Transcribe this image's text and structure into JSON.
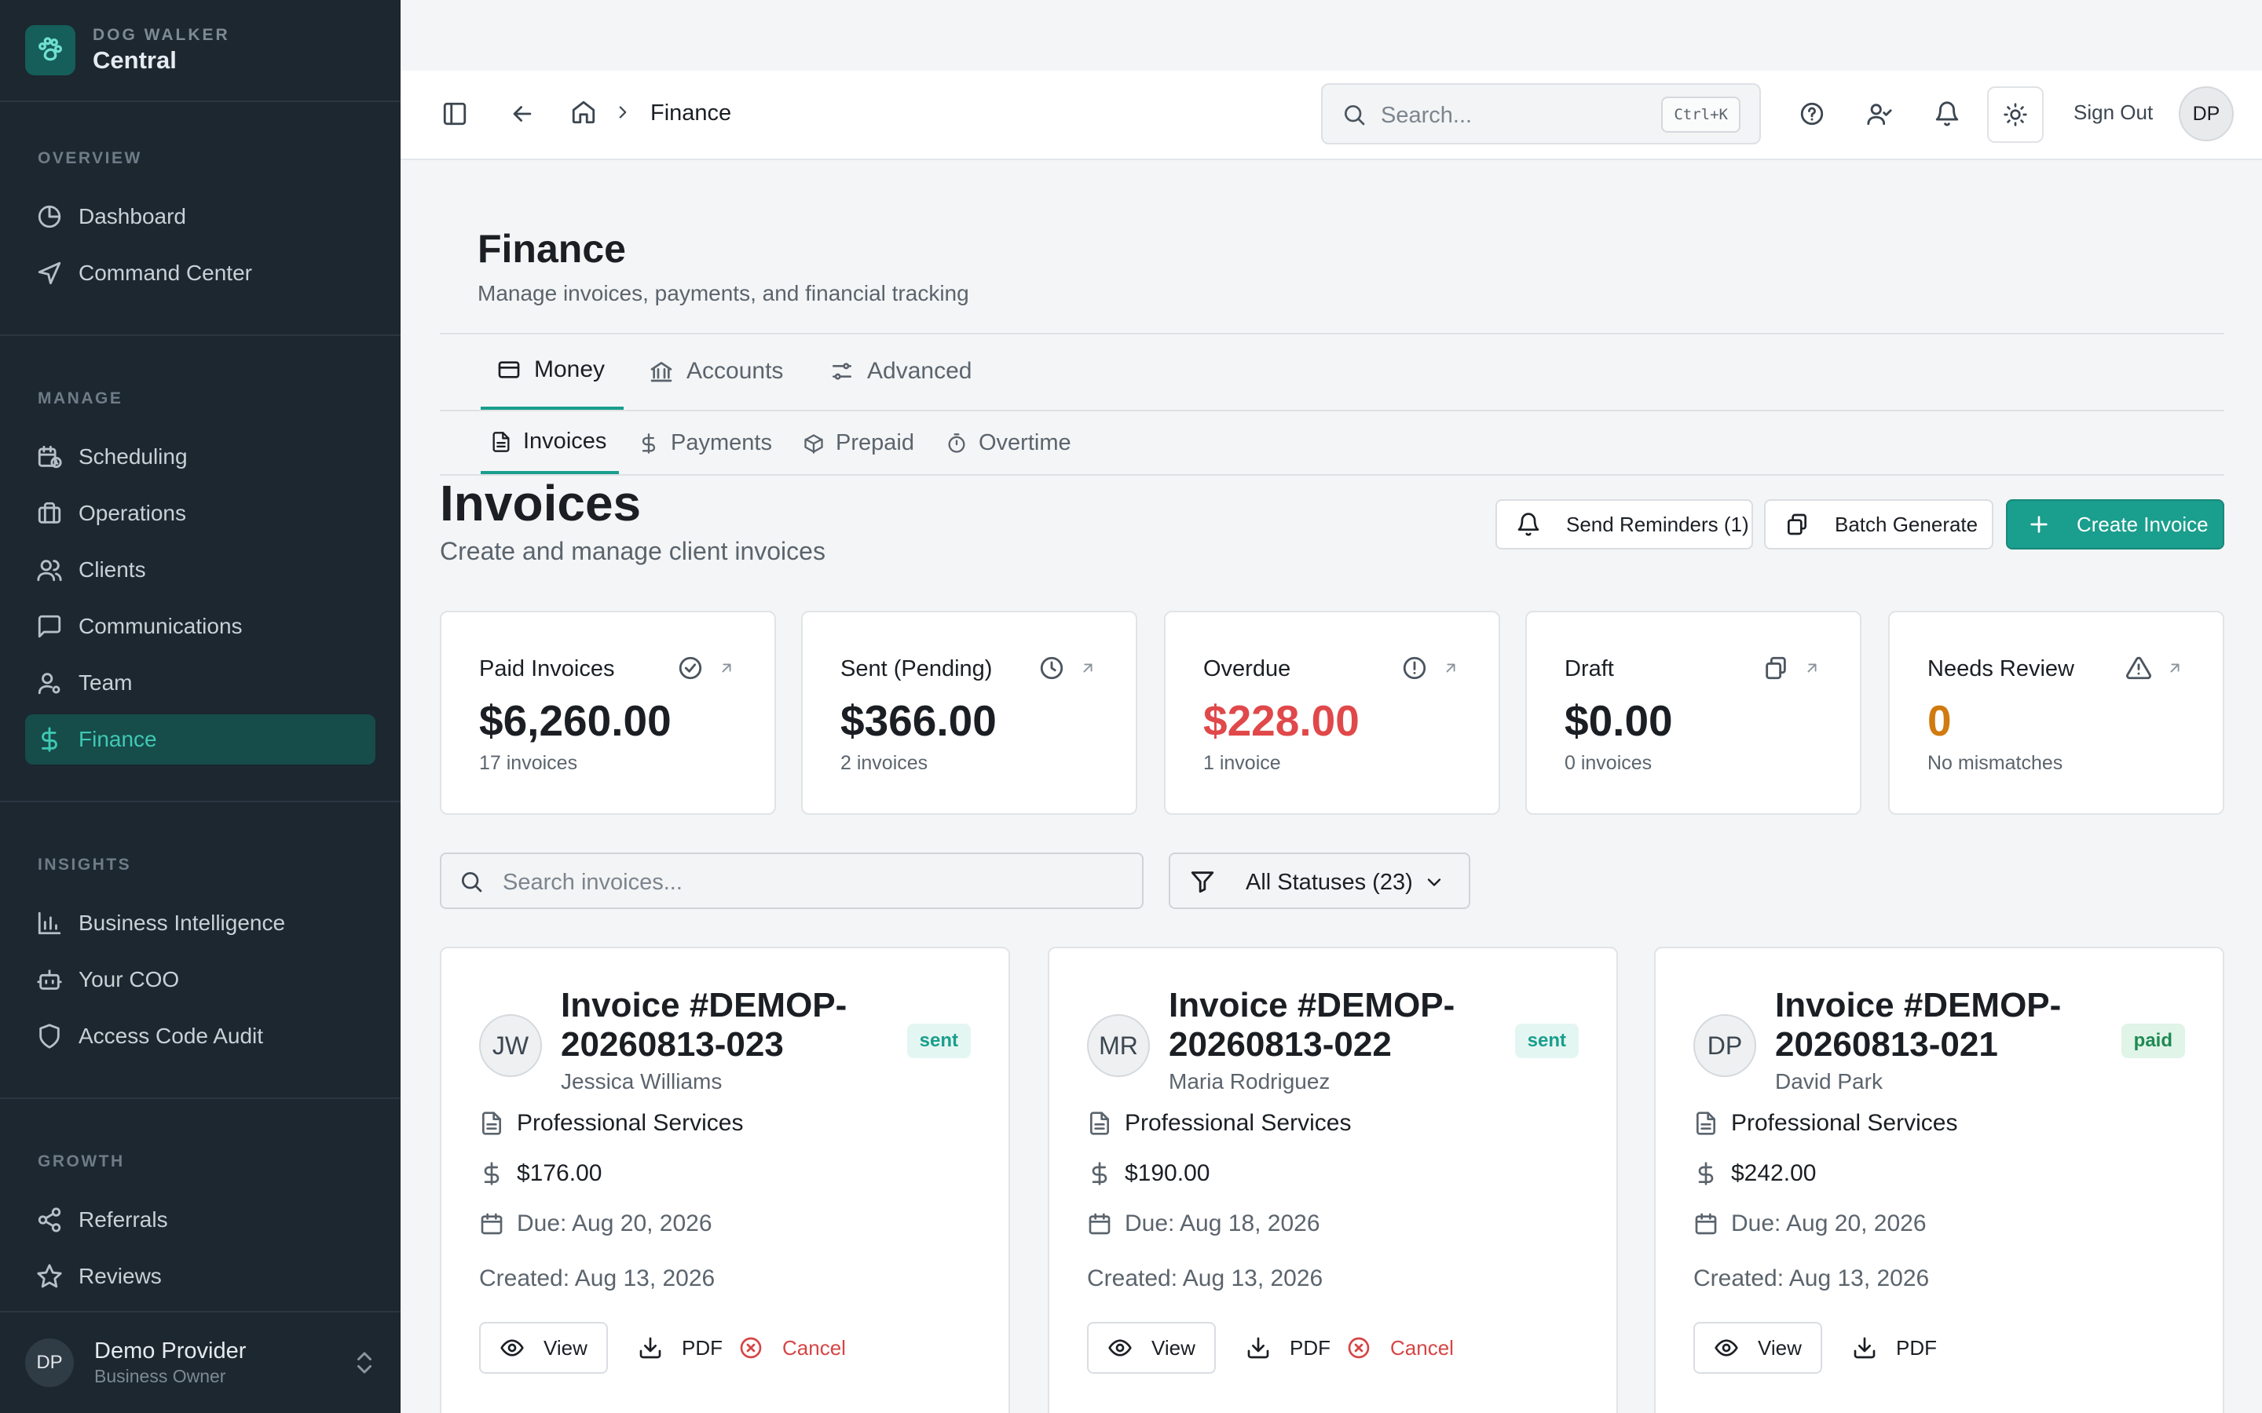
{
  "brand": {
    "subtitle": "DOG WALKER",
    "title": "Central",
    "icon": "paw-icon",
    "accent": "#1a9e8d"
  },
  "sidebar": {
    "sections": [
      {
        "label": "OVERVIEW"
      },
      {
        "label": "MANAGE"
      },
      {
        "label": "INSIGHTS"
      },
      {
        "label": "GROWTH"
      }
    ],
    "items": [
      {
        "label": "Dashboard",
        "icon": "pie-chart-icon"
      },
      {
        "label": "Command Center",
        "icon": "navigation-icon"
      },
      {
        "label": "Scheduling",
        "icon": "calendar-clock-icon"
      },
      {
        "label": "Operations",
        "icon": "briefcase-icon"
      },
      {
        "label": "Clients",
        "icon": "users-icon"
      },
      {
        "label": "Communications",
        "icon": "message-square-icon"
      },
      {
        "label": "Team",
        "icon": "user-cog-icon"
      },
      {
        "label": "Finance",
        "icon": "dollar-icon",
        "active": true
      },
      {
        "label": "Business Intelligence",
        "icon": "bar-chart-icon"
      },
      {
        "label": "Your COO",
        "icon": "bot-icon"
      },
      {
        "label": "Access Code Audit",
        "icon": "shield-icon"
      },
      {
        "label": "Referrals",
        "icon": "share-icon"
      },
      {
        "label": "Reviews",
        "icon": "star-icon"
      }
    ],
    "user": {
      "initials": "DP",
      "name": "Demo Provider",
      "role": "Business Owner"
    }
  },
  "topbar": {
    "breadcrumb": "Finance",
    "search": {
      "placeholder": "Search...",
      "shortcut": "Ctrl+K"
    },
    "sign_out": "Sign Out",
    "avatar": "DP"
  },
  "page": {
    "title": "Finance",
    "subtitle": "Manage invoices, payments, and financial tracking"
  },
  "tabs": [
    {
      "label": "Money",
      "icon": "wallet-icon",
      "active": true
    },
    {
      "label": "Accounts",
      "icon": "bank-icon"
    },
    {
      "label": "Advanced",
      "icon": "settings-sliders-icon"
    }
  ],
  "subtabs": [
    {
      "label": "Invoices",
      "icon": "file-text-icon",
      "active": true
    },
    {
      "label": "Payments",
      "icon": "dollar-icon"
    },
    {
      "label": "Prepaid",
      "icon": "package-icon"
    },
    {
      "label": "Overtime",
      "icon": "timer-icon"
    }
  ],
  "section": {
    "title": "Invoices",
    "subtitle": "Create and manage client invoices",
    "actions": {
      "reminders": "Send Reminders (1)",
      "batch": "Batch Generate",
      "create": "Create Invoice"
    }
  },
  "stats": [
    {
      "label": "Paid Invoices",
      "value": "$6,260.00",
      "note": "17 invoices",
      "icon": "check-circle-icon",
      "color": "#1b1f24"
    },
    {
      "label": "Sent (Pending)",
      "value": "$366.00",
      "note": "2 invoices",
      "icon": "clock-icon",
      "color": "#1b1f24"
    },
    {
      "label": "Overdue",
      "value": "$228.00",
      "note": "1 invoice",
      "icon": "alert-circle-icon",
      "color": "#e0484a"
    },
    {
      "label": "Draft",
      "value": "$0.00",
      "note": "0 invoices",
      "icon": "copy-icon",
      "color": "#1b1f24"
    },
    {
      "label": "Needs Review",
      "value": "0",
      "note": "No mismatches",
      "icon": "alert-triangle-icon",
      "color": "#d07a10"
    }
  ],
  "filters": {
    "search_placeholder": "Search invoices...",
    "status": "All Statuses (23)"
  },
  "invoices": [
    {
      "initials": "JW",
      "title": "Invoice #DEMOP-20260813-023",
      "client": "Jessica Williams",
      "status": "sent",
      "service": "Professional Services",
      "amount": "$176.00",
      "due": "Due: Aug 20, 2026",
      "created": "Created: Aug 13, 2026",
      "view": "View",
      "pdf": "PDF",
      "cancel": "Cancel"
    },
    {
      "initials": "MR",
      "title": "Invoice #DEMOP-20260813-022",
      "client": "Maria Rodriguez",
      "status": "sent",
      "service": "Professional Services",
      "amount": "$190.00",
      "due": "Due: Aug 18, 2026",
      "created": "Created: Aug 13, 2026",
      "view": "View",
      "pdf": "PDF",
      "cancel": "Cancel"
    },
    {
      "initials": "DP",
      "title": "Invoice #DEMOP-20260813-021",
      "client": "David Park",
      "status": "paid",
      "service": "Professional Services",
      "amount": "$242.00",
      "due": "Due: Aug 20, 2026",
      "created": "Created: Aug 13, 2026",
      "view": "View",
      "pdf": "PDF"
    }
  ]
}
